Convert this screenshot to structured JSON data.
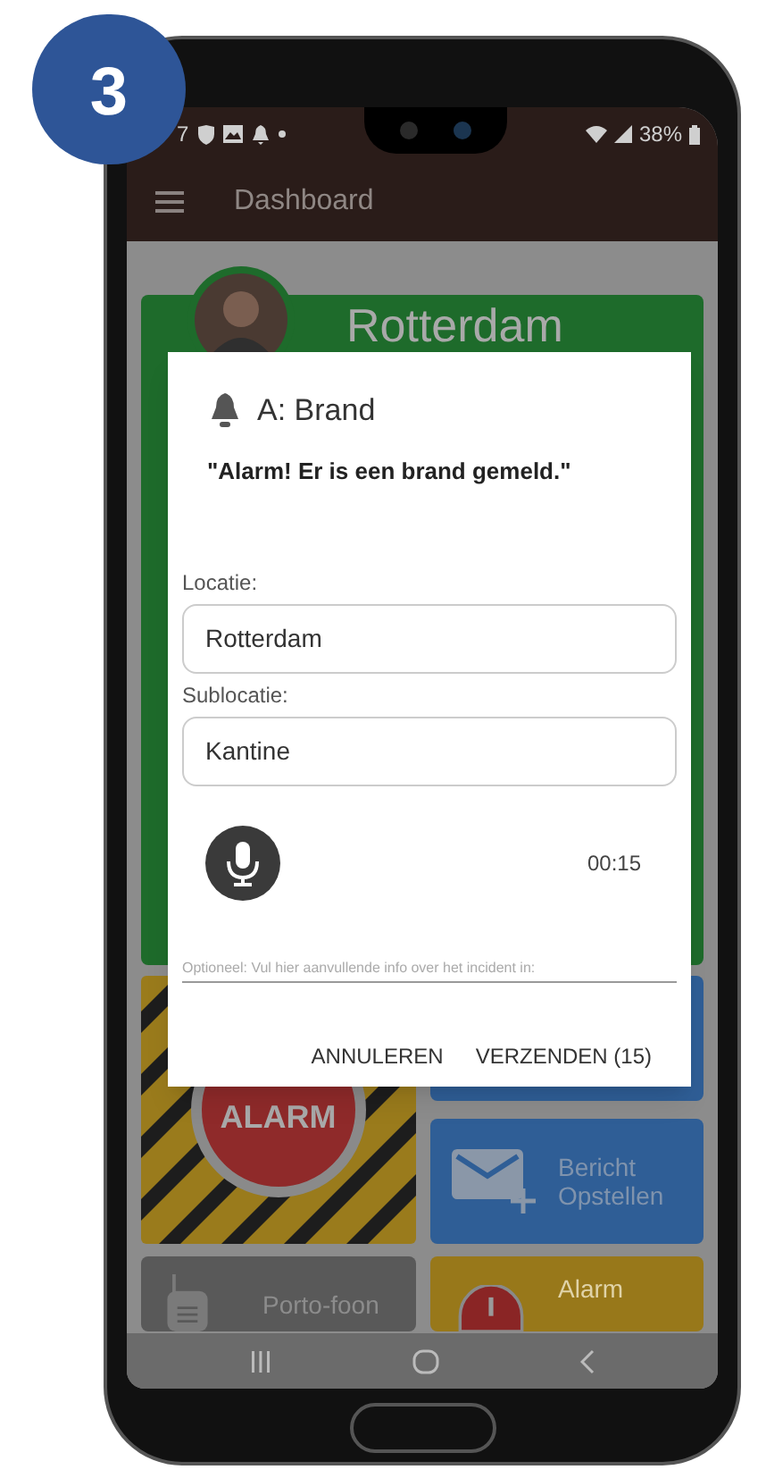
{
  "badge": {
    "number": "3"
  },
  "status_bar": {
    "time": "7",
    "battery": "38%"
  },
  "app_bar": {
    "title": "Dashboard"
  },
  "location_card": {
    "location": "Rotterdam"
  },
  "tiles": [
    {
      "kind": "alarm",
      "label": "ALARM"
    },
    {
      "kind": "blank"
    },
    {
      "kind": "message",
      "label": "Bericht Opstellen"
    },
    {
      "kind": "walkie",
      "label": "Porto-foon"
    },
    {
      "kind": "alert",
      "label": "Alarm"
    }
  ],
  "dialog": {
    "title": "A: Brand",
    "message": "\"Alarm! Er is een brand gemeld.\"",
    "fields": [
      {
        "label": "Locatie:",
        "value": "Rotterdam"
      },
      {
        "label": "Sublocatie:",
        "value": "Kantine"
      }
    ],
    "recording": {
      "time": "00:15"
    },
    "notes": {
      "placeholder": "Optioneel: Vul hier aanvullende info over het incident in:"
    },
    "buttons": [
      "ANNULEREN",
      "VERZENDEN (15)"
    ]
  }
}
